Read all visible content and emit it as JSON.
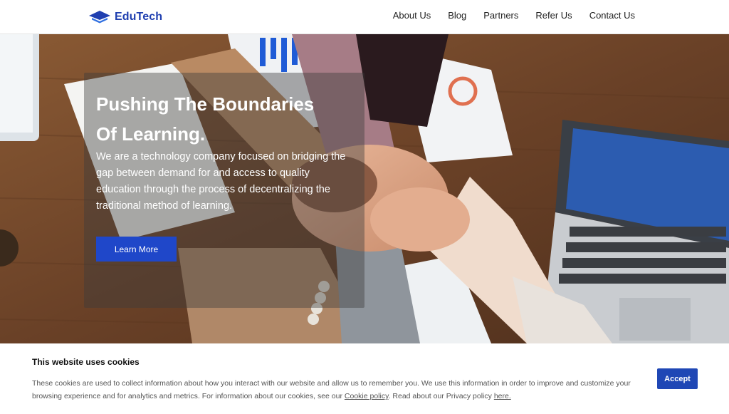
{
  "brand": {
    "name": "EduTech",
    "color": "#1f3fb0"
  },
  "nav": {
    "items": [
      {
        "label": "About Us"
      },
      {
        "label": "Blog"
      },
      {
        "label": "Partners"
      },
      {
        "label": "Refer Us"
      },
      {
        "label": "Contact Us"
      }
    ]
  },
  "hero": {
    "title_line1": "Pushing The Boundaries",
    "title_line2": "Of Learning.",
    "description": "We are a technology company focused on bridging the gap between demand for and access to quality education through the process of decentralizing the traditional method of learning.",
    "cta_label": "Learn More",
    "cta_color": "#1f47c9"
  },
  "cookie_banner": {
    "title": "This website uses cookies",
    "text_part1": "These cookies are used to collect information about how you interact with our website and allow us to remember you. We use this information in order to improve and customize your browsing experience and for analytics and metrics. For information about our cookies, see our ",
    "cookie_policy_link": "Cookie policy",
    "text_part2": ". Read about our Privacy policy ",
    "here_link": "here.",
    "accept_label": "Accept",
    "accept_color": "#1f47b5"
  }
}
